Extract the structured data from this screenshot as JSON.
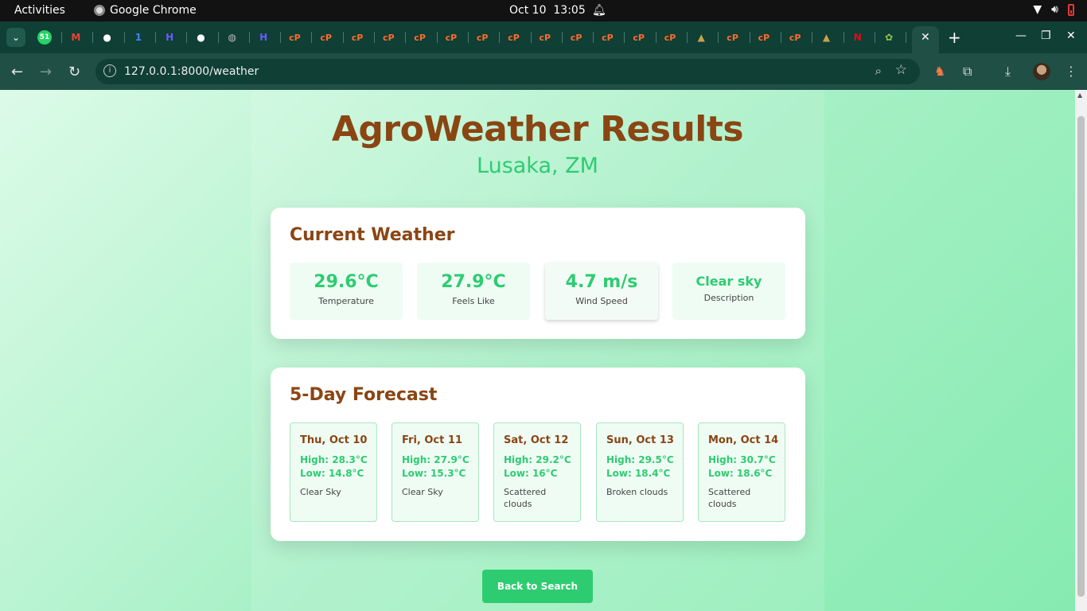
{
  "system": {
    "activities": "Activities",
    "app_name": "Google Chrome",
    "date": "Oct 10",
    "time": "13:05"
  },
  "browser": {
    "url": "127.0.0.1:8000/weather",
    "tab_badge": "51",
    "tabs": [
      {
        "icon": "whatsapp-icon",
        "color": "#25d366"
      },
      {
        "icon": "gmail-icon",
        "color": "#ea4335"
      },
      {
        "icon": "github-icon",
        "color": "#ffffff"
      },
      {
        "icon": "one-icon",
        "color": "#4285f4"
      },
      {
        "icon": "h-icon",
        "color": "#6b5bff"
      },
      {
        "icon": "github-icon",
        "color": "#ffffff"
      },
      {
        "icon": "globe-icon",
        "color": "#bbbbbb"
      },
      {
        "icon": "h-icon",
        "color": "#6b5bff"
      },
      {
        "icon": "cpanel-icon",
        "color": "#ff6c2c"
      },
      {
        "icon": "cpanel-icon",
        "color": "#ff6c2c"
      },
      {
        "icon": "cpanel-icon",
        "color": "#ff6c2c"
      },
      {
        "icon": "cpanel-icon",
        "color": "#ff6c2c"
      },
      {
        "icon": "cpanel-icon",
        "color": "#ff6c2c"
      },
      {
        "icon": "cpanel-icon",
        "color": "#ff6c2c"
      },
      {
        "icon": "cpanel-icon",
        "color": "#ff6c2c"
      },
      {
        "icon": "cpanel-icon",
        "color": "#ff6c2c"
      },
      {
        "icon": "cpanel-icon",
        "color": "#ff6c2c"
      },
      {
        "icon": "cpanel-icon",
        "color": "#ff6c2c"
      },
      {
        "icon": "cpanel-icon",
        "color": "#ff6c2c"
      },
      {
        "icon": "cpanel-icon",
        "color": "#ff6c2c"
      },
      {
        "icon": "cpanel-icon",
        "color": "#ff6c2c"
      },
      {
        "icon": "sail-icon",
        "color": "#c8a24a"
      },
      {
        "icon": "cpanel-icon",
        "color": "#ff6c2c"
      },
      {
        "icon": "cpanel-icon",
        "color": "#ff6c2c"
      },
      {
        "icon": "cpanel-icon",
        "color": "#ff6c2c"
      },
      {
        "icon": "sail-icon",
        "color": "#c8a24a"
      },
      {
        "icon": "netflix-icon",
        "color": "#e50914"
      },
      {
        "icon": "frog-icon",
        "color": "#8bc34a"
      }
    ]
  },
  "page": {
    "title": "AgroWeather Results",
    "location": "Lusaka, ZM",
    "current": {
      "heading": "Current Weather",
      "stats": [
        {
          "value": "29.6°C",
          "label": "Temperature"
        },
        {
          "value": "27.9°C",
          "label": "Feels Like"
        },
        {
          "value": "4.7 m/s",
          "label": "Wind Speed"
        },
        {
          "value": "Clear sky",
          "label": "Description"
        }
      ]
    },
    "forecast": {
      "heading": "5-Day Forecast",
      "days": [
        {
          "date": "Thu, Oct 10",
          "high": "High: 28.3°C",
          "low": "Low: 14.8°C",
          "desc": "Clear Sky"
        },
        {
          "date": "Fri, Oct 11",
          "high": "High: 27.9°C",
          "low": "Low: 15.3°C",
          "desc": "Clear Sky"
        },
        {
          "date": "Sat, Oct 12",
          "high": "High: 29.2°C",
          "low": "Low: 16°C",
          "desc": "Scattered clouds"
        },
        {
          "date": "Sun, Oct 13",
          "high": "High: 29.5°C",
          "low": "Low: 18.4°C",
          "desc": "Broken clouds"
        },
        {
          "date": "Mon, Oct 14",
          "high": "High: 30.7°C",
          "low": "Low: 18.6°C",
          "desc": "Scattered clouds"
        }
      ]
    },
    "back_button": "Back to Search"
  },
  "colors": {
    "brown": "#8a4513",
    "green": "#2ecc71",
    "tab_strip": "#0f3f35",
    "toolbar": "#1f4f45"
  }
}
